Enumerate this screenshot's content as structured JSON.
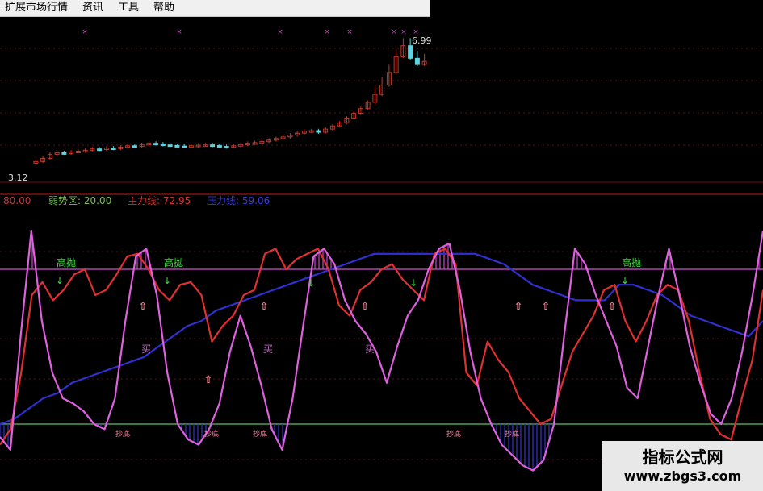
{
  "menu": [
    "扩展市场行情",
    "资讯",
    "工具",
    "帮助"
  ],
  "price_panel": {
    "high_label": "6.99",
    "low_label": "3.12",
    "up_color": "#c0392b",
    "down_color": "#5fd3e0"
  },
  "indicator_legend": [
    {
      "text": "80.00",
      "color": "#c23a3a"
    },
    {
      "text": "弱势区: 20.00",
      "color": "#7bbf5a"
    },
    {
      "text": "主力线: 72.95",
      "color": "#d83030"
    },
    {
      "text": "压力线: 59.06",
      "color": "#3a3adf"
    }
  ],
  "signals": {
    "high_sell": "高抛",
    "buy": "买",
    "buy_low": "抄底",
    "buy_low_color": "#ff7fa0",
    "high_sell_color": "#40e040",
    "buy_color": "#c060c0"
  },
  "watermark": {
    "title": "指标公式网",
    "url": "www.zbgs3.com"
  },
  "chart_data": [
    {
      "type": "candlestick",
      "title": "",
      "price_labels": {
        "high": 6.99,
        "low": 3.12
      },
      "close": [
        3.12,
        3.22,
        3.35,
        3.4,
        3.38,
        3.42,
        3.45,
        3.48,
        3.52,
        3.5,
        3.55,
        3.53,
        3.58,
        3.62,
        3.6,
        3.66,
        3.7,
        3.68,
        3.65,
        3.63,
        3.61,
        3.6,
        3.62,
        3.64,
        3.65,
        3.63,
        3.6,
        3.58,
        3.62,
        3.66,
        3.7,
        3.72,
        3.76,
        3.8,
        3.85,
        3.9,
        3.96,
        4.02,
        4.08,
        4.1,
        4.05,
        4.15,
        4.25,
        4.35,
        4.5,
        4.65,
        4.8,
        5.0,
        5.25,
        5.55,
        5.95,
        6.45,
        6.8,
        6.4,
        6.2,
        6.3
      ]
    },
    {
      "type": "line",
      "title": "",
      "levels": {
        "strong": 80,
        "weak": 20
      },
      "series": [
        {
          "name": "主力线",
          "color": "#e03030",
          "values": [
            12,
            18,
            40,
            70,
            75,
            68,
            72,
            78,
            80,
            70,
            72,
            78,
            85,
            86,
            80,
            72,
            68,
            74,
            75,
            70,
            52,
            58,
            62,
            70,
            72,
            86,
            88,
            80,
            84,
            86,
            88,
            80,
            66,
            62,
            72,
            75,
            80,
            82,
            76,
            72,
            68,
            86,
            88,
            82,
            40,
            35,
            52,
            45,
            40,
            30,
            25,
            20,
            22,
            35,
            48,
            55,
            62,
            72,
            74,
            60,
            52,
            60,
            70,
            74,
            72,
            60,
            40,
            22,
            16,
            14,
            30,
            45,
            72
          ]
        },
        {
          "name": "压力线",
          "color": "#3030d0",
          "values": [
            20,
            22,
            26,
            30,
            32,
            36,
            38,
            40,
            42,
            44,
            46,
            50,
            54,
            58,
            60,
            64,
            66,
            68,
            70,
            72,
            74,
            76,
            78,
            80,
            82,
            84,
            86,
            86,
            86,
            86,
            86,
            86,
            86,
            86,
            84,
            82,
            78,
            74,
            72,
            70,
            68,
            68,
            68,
            74,
            74,
            72,
            70,
            66,
            62,
            60,
            58,
            56,
            54,
            60
          ]
        },
        {
          "name": "",
          "color": "#e060e0",
          "values": [
            15,
            10,
            55,
            95,
            60,
            40,
            30,
            28,
            25,
            20,
            18,
            30,
            60,
            85,
            88,
            70,
            40,
            20,
            14,
            12,
            18,
            28,
            48,
            62,
            50,
            35,
            18,
            10,
            30,
            58,
            85,
            88,
            82,
            68,
            60,
            55,
            48,
            36,
            50,
            62,
            68,
            80,
            88,
            90,
            72,
            48,
            30,
            20,
            12,
            8,
            4,
            2,
            6,
            20,
            55,
            88,
            82,
            70,
            60,
            50,
            34,
            30,
            50,
            70,
            88,
            70,
            50,
            36,
            24,
            20,
            30,
            48,
            70,
            95
          ]
        }
      ]
    }
  ]
}
